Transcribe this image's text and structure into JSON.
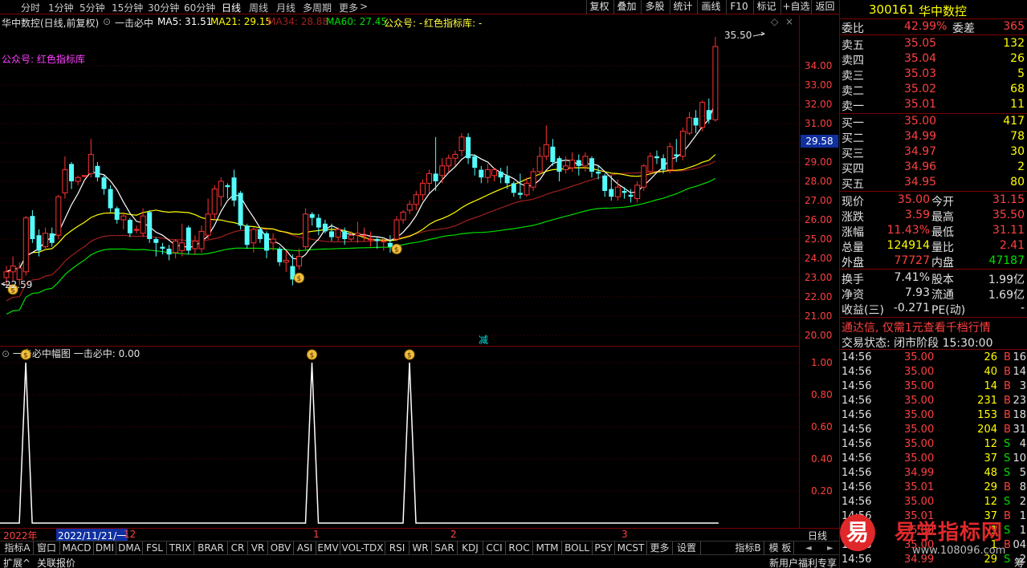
{
  "toolbar": {
    "periods": [
      "分时",
      "1分钟",
      "5分钟",
      "15分钟",
      "30分钟",
      "60分钟",
      "日线",
      "周线",
      "月线",
      "多周期",
      "更多"
    ],
    "more_arrow": ">",
    "buttons": [
      "复权",
      "叠加",
      "多股",
      "统计",
      "画线",
      "F10",
      "标记",
      "+自选",
      "返回"
    ]
  },
  "info": {
    "stock_title": "华中数控(日线,前复权)",
    "indicator": "一击必中",
    "ma5": "MA5: 31.51",
    "ma21": "MA21: 29.15",
    "ma34": "MA34: 28.88",
    "ma60": "MA60: 27.45",
    "gzh": "公众号: -",
    "hszb": "红色指标库: -"
  },
  "main": {
    "watermark": "公众号: 红色指标库",
    "high_label": "35.50",
    "low_label": "22.59",
    "bottom_mark": "减",
    "current_price": "29.58",
    "y_ticks": [
      "34.00",
      "33.00",
      "32.00",
      "31.00",
      "30.00",
      "29.00",
      "28.00",
      "27.00",
      "26.00",
      "25.00",
      "24.00",
      "23.00",
      "22.00",
      "21.00",
      "20.00"
    ]
  },
  "sub": {
    "title": "一击必中幅图",
    "value": "一击必中: 0.00",
    "y_ticks": [
      "1.00",
      "0.80",
      "0.60",
      "0.40",
      "0.20"
    ]
  },
  "dateaxis": {
    "year": "2022年",
    "cursor": "2022/11/21/一",
    "m12": "12",
    "m1": "1",
    "m2": "2",
    "m3": "3",
    "right": "日线"
  },
  "indicators": [
    "指标A",
    "窗口",
    "MACD",
    "DMI",
    "DMA",
    "FSL",
    "TRIX",
    "BRAR",
    "CR",
    "VR",
    "OBV",
    "ASI",
    "EMV",
    "VOL-TDX",
    "RSI",
    "WR",
    "SAR",
    "KDJ",
    "CCI",
    "ROC",
    "MTM",
    "BOLL",
    "PSY",
    "MCST",
    "更多",
    "设置"
  ],
  "ind_right": [
    "指标B",
    "模 板"
  ],
  "status": {
    "expand": "扩展^",
    "related": "关联报价",
    "nav_l": "◄",
    "nav_r": "►",
    "new_user": "新用户福利专享"
  },
  "quote": {
    "code": "300161",
    "name": "华中数控",
    "weibi_label": "委比",
    "weibi": "42.99%",
    "weicha_label": "委差",
    "weicha": "365",
    "asks": [
      {
        "label": "卖五",
        "price": "35.05",
        "vol": "132"
      },
      {
        "label": "卖四",
        "price": "35.04",
        "vol": "26"
      },
      {
        "label": "卖三",
        "price": "35.03",
        "vol": "5"
      },
      {
        "label": "卖二",
        "price": "35.02",
        "vol": "68"
      },
      {
        "label": "卖一",
        "price": "35.01",
        "vol": "11"
      }
    ],
    "bids": [
      {
        "label": "买一",
        "price": "35.00",
        "vol": "417"
      },
      {
        "label": "买二",
        "price": "34.99",
        "vol": "78"
      },
      {
        "label": "买三",
        "price": "34.97",
        "vol": "30"
      },
      {
        "label": "买四",
        "price": "34.96",
        "vol": "2"
      },
      {
        "label": "买五",
        "price": "34.95",
        "vol": "80"
      }
    ],
    "stats": [
      {
        "l1": "现价",
        "v1": "35.00",
        "c1": "#ff4040",
        "l2": "今开",
        "v2": "31.15",
        "c2": "#ff4040"
      },
      {
        "l1": "涨跌",
        "v1": "3.59",
        "c1": "#ff4040",
        "l2": "最高",
        "v2": "35.50",
        "c2": "#ff4040"
      },
      {
        "l1": "涨幅",
        "v1": "11.43%",
        "c1": "#ff4040",
        "l2": "最低",
        "v2": "31.11",
        "c2": "#ff4040"
      },
      {
        "l1": "总量",
        "v1": "124914",
        "c1": "#ffff00",
        "l2": "量比",
        "v2": "2.41",
        "c2": "#ff4040"
      },
      {
        "l1": "外盘",
        "v1": "77727",
        "c1": "#ff4040",
        "l2": "内盘",
        "v2": "47187",
        "c2": "#00e000"
      }
    ],
    "stats2": [
      {
        "l1": "换手",
        "v1": "7.41%",
        "l2": "股本",
        "v2": "1.99亿"
      },
      {
        "l1": "净资",
        "v1": "7.93",
        "l2": "流通",
        "v2": "1.69亿"
      },
      {
        "l1": "收益(三)",
        "v1": "-0.271",
        "l2": "PE(动)",
        "v2": "-"
      }
    ],
    "promo": "通达信, 仅需1元查看千档行情",
    "trade_status": "交易状态: 闭市阶段 15:30:00",
    "ticks": [
      {
        "t": "14:56",
        "p": "35.00",
        "v": "26",
        "s": "B",
        "n": "16"
      },
      {
        "t": "14:56",
        "p": "35.00",
        "v": "40",
        "s": "B",
        "n": "14"
      },
      {
        "t": "14:56",
        "p": "35.00",
        "v": "14",
        "s": "B",
        "n": "3"
      },
      {
        "t": "14:56",
        "p": "35.00",
        "v": "231",
        "s": "B",
        "n": "23"
      },
      {
        "t": "14:56",
        "p": "35.00",
        "v": "153",
        "s": "B",
        "n": "18"
      },
      {
        "t": "14:56",
        "p": "35.00",
        "v": "204",
        "s": "B",
        "n": "31"
      },
      {
        "t": "14:56",
        "p": "35.00",
        "v": "12",
        "s": "S",
        "n": "4"
      },
      {
        "t": "14:56",
        "p": "35.00",
        "v": "37",
        "s": "S",
        "n": "10"
      },
      {
        "t": "14:56",
        "p": "34.99",
        "v": "48",
        "s": "S",
        "n": "5"
      },
      {
        "t": "14:56",
        "p": "35.01",
        "v": "29",
        "s": "B",
        "n": "8"
      },
      {
        "t": "14:56",
        "p": "35.00",
        "v": "12",
        "s": "S",
        "n": "2"
      },
      {
        "t": "14:56",
        "p": "35.01",
        "v": "37",
        "s": "B",
        "n": "1"
      },
      {
        "t": "14:56",
        "p": "35.00",
        "v": "1",
        "s": "S",
        "n": "1"
      },
      {
        "t": "14:56",
        "p": "35.00",
        "v": "1",
        "s": "B",
        "n": "04"
      },
      {
        "t": "14:56",
        "p": "34.99",
        "v": "29",
        "s": "S",
        "n": "2"
      }
    ],
    "footer": "筹"
  },
  "brand": {
    "logo_char": "易",
    "name": "易学指标网",
    "url": "www.108096.com"
  },
  "chart_data": {
    "type": "candlestick",
    "ylim": [
      20,
      35.5
    ],
    "candles": [
      [
        23.0,
        23.3,
        22.6,
        23.6
      ],
      [
        23.3,
        23.6,
        22.8,
        24.1
      ],
      [
        22.9,
        23.5,
        22.6,
        23.8
      ],
      [
        23.3,
        26.1,
        23.1,
        26.2
      ],
      [
        26.2,
        25.0,
        24.8,
        26.5
      ],
      [
        25.2,
        24.4,
        24.1,
        25.5
      ],
      [
        24.6,
        25.3,
        24.4,
        25.6
      ],
      [
        25.3,
        24.8,
        24.6,
        25.6
      ],
      [
        25.2,
        27.2,
        25.0,
        27.3
      ],
      [
        27.4,
        28.6,
        27.1,
        29.3
      ],
      [
        28.9,
        28.0,
        27.6,
        29.0
      ],
      [
        28.0,
        28.2,
        27.8,
        28.3
      ],
      [
        28.3,
        28.3,
        28.2,
        28.3
      ],
      [
        28.4,
        29.4,
        28.2,
        30.2
      ],
      [
        28.8,
        28.2,
        28.0,
        29.0
      ],
      [
        28.2,
        27.6,
        27.3,
        28.3
      ],
      [
        27.6,
        26.6,
        26.4,
        27.8
      ],
      [
        26.6,
        26.0,
        25.8,
        26.7
      ],
      [
        26.0,
        26.2,
        25.5,
        26.4
      ],
      [
        26.0,
        25.3,
        25.1,
        26.1
      ],
      [
        25.5,
        25.5,
        25.3,
        25.7
      ],
      [
        25.3,
        26.2,
        25.1,
        26.6
      ],
      [
        26.4,
        25.0,
        24.8,
        26.5
      ],
      [
        25.0,
        24.8,
        24.1,
        25.1
      ],
      [
        24.6,
        24.5,
        24.2,
        24.8
      ],
      [
        24.5,
        24.2,
        23.9,
        24.7
      ],
      [
        24.3,
        24.9,
        24.0,
        25.0
      ],
      [
        24.4,
        24.8,
        24.1,
        25.8
      ],
      [
        25.6,
        24.4,
        24.2,
        25.7
      ],
      [
        24.5,
        24.9,
        24.2,
        25.2
      ],
      [
        24.5,
        25.4,
        24.3,
        25.7
      ],
      [
        25.2,
        26.3,
        25.0,
        27.1
      ],
      [
        26.3,
        27.6,
        26.0,
        27.8
      ],
      [
        27.2,
        28.0,
        26.7,
        28.2
      ],
      [
        27.8,
        27.7,
        27.1,
        27.9
      ],
      [
        28.2,
        27.0,
        26.7,
        28.6
      ],
      [
        27.4,
        25.7,
        25.5,
        27.5
      ],
      [
        25.7,
        24.7,
        24.5,
        25.8
      ],
      [
        24.8,
        25.5,
        24.3,
        25.6
      ],
      [
        25.5,
        25.0,
        24.8,
        25.6
      ],
      [
        25.3,
        24.4,
        24.0,
        25.4
      ],
      [
        24.8,
        25.0,
        24.4,
        25.3
      ],
      [
        24.5,
        23.8,
        23.6,
        24.6
      ],
      [
        23.8,
        23.9,
        23.3,
        24.4
      ],
      [
        23.6,
        22.9,
        22.6,
        24.2
      ],
      [
        23.6,
        24.1,
        23.4,
        24.5
      ],
      [
        24.6,
        26.3,
        24.4,
        26.6
      ],
      [
        26.3,
        26.1,
        25.7,
        26.4
      ],
      [
        26.1,
        25.6,
        25.2,
        26.3
      ],
      [
        25.8,
        25.4,
        25.3,
        26.0
      ],
      [
        25.4,
        25.1,
        24.9,
        25.8
      ],
      [
        25.1,
        25.5,
        24.9,
        25.6
      ],
      [
        25.4,
        25.0,
        24.7,
        25.6
      ],
      [
        25.0,
        25.2,
        24.9,
        25.4
      ],
      [
        25.2,
        25.3,
        24.8,
        25.9
      ],
      [
        25.2,
        25.2,
        24.9,
        25.6
      ],
      [
        25.0,
        25.0,
        24.6,
        25.4
      ],
      [
        25.0,
        24.9,
        24.5,
        25.1
      ],
      [
        24.9,
        24.9,
        24.4,
        25.0
      ],
      [
        24.8,
        24.6,
        24.3,
        25.2
      ],
      [
        25.0,
        26.0,
        24.9,
        26.2
      ],
      [
        26.0,
        26.4,
        25.8,
        26.5
      ],
      [
        26.5,
        26.8,
        26.3,
        27.0
      ],
      [
        26.8,
        27.3,
        26.5,
        27.5
      ],
      [
        27.3,
        27.9,
        27.0,
        28.1
      ],
      [
        27.9,
        28.4,
        27.4,
        28.6
      ],
      [
        28.4,
        28.0,
        27.5,
        30.3
      ],
      [
        28.3,
        28.8,
        27.9,
        29.2
      ],
      [
        28.8,
        29.2,
        28.5,
        29.4
      ],
      [
        29.2,
        29.4,
        28.8,
        29.6
      ],
      [
        29.6,
        30.3,
        29.3,
        30.5
      ],
      [
        30.3,
        29.2,
        28.9,
        30.5
      ],
      [
        29.3,
        28.7,
        28.3,
        29.4
      ],
      [
        28.6,
        28.2,
        27.9,
        28.8
      ],
      [
        28.2,
        28.6,
        27.9,
        28.9
      ],
      [
        28.3,
        28.6,
        28.0,
        28.7
      ],
      [
        28.5,
        28.2,
        27.9,
        28.7
      ],
      [
        28.3,
        27.9,
        27.6,
        28.8
      ],
      [
        27.9,
        27.4,
        27.2,
        28.0
      ],
      [
        27.4,
        27.3,
        27.1,
        28.4
      ],
      [
        27.3,
        27.9,
        27.2,
        28.2
      ],
      [
        27.7,
        28.5,
        27.5,
        28.7
      ],
      [
        28.5,
        29.3,
        28.3,
        29.8
      ],
      [
        29.3,
        29.9,
        29.1,
        30.9
      ],
      [
        29.8,
        29.0,
        28.8,
        30.2
      ],
      [
        29.2,
        28.5,
        28.0,
        29.3
      ],
      [
        28.6,
        28.8,
        28.4,
        29.3
      ],
      [
        28.7,
        29.1,
        28.5,
        29.5
      ],
      [
        29.1,
        28.8,
        28.3,
        29.4
      ],
      [
        28.8,
        29.3,
        28.5,
        29.5
      ],
      [
        29.2,
        28.5,
        28.2,
        29.3
      ],
      [
        28.5,
        28.4,
        28.1,
        28.8
      ],
      [
        28.3,
        27.5,
        27.2,
        28.4
      ],
      [
        27.6,
        27.2,
        27.0,
        28.3
      ],
      [
        27.2,
        27.7,
        27.0,
        28.1
      ],
      [
        27.5,
        27.4,
        27.1,
        27.7
      ],
      [
        27.3,
        27.2,
        26.9,
        27.6
      ],
      [
        27.1,
        27.8,
        26.9,
        28.0
      ],
      [
        27.7,
        28.8,
        27.5,
        28.9
      ],
      [
        28.5,
        29.3,
        28.3,
        29.5
      ],
      [
        29.3,
        29.2,
        28.9,
        29.6
      ],
      [
        29.2,
        28.6,
        28.4,
        29.4
      ],
      [
        28.6,
        29.8,
        28.4,
        30.0
      ],
      [
        29.4,
        29.3,
        29.0,
        30.2
      ],
      [
        29.3,
        30.6,
        29.1,
        30.8
      ],
      [
        30.5,
        31.3,
        30.4,
        31.6
      ],
      [
        31.3,
        30.9,
        30.5,
        31.7
      ],
      [
        30.8,
        32.1,
        30.6,
        32.2
      ],
      [
        31.7,
        31.2,
        31.0,
        32.3
      ],
      [
        31.2,
        35.0,
        31.1,
        35.5
      ]
    ],
    "signals": [
      1,
      45,
      60
    ]
  }
}
